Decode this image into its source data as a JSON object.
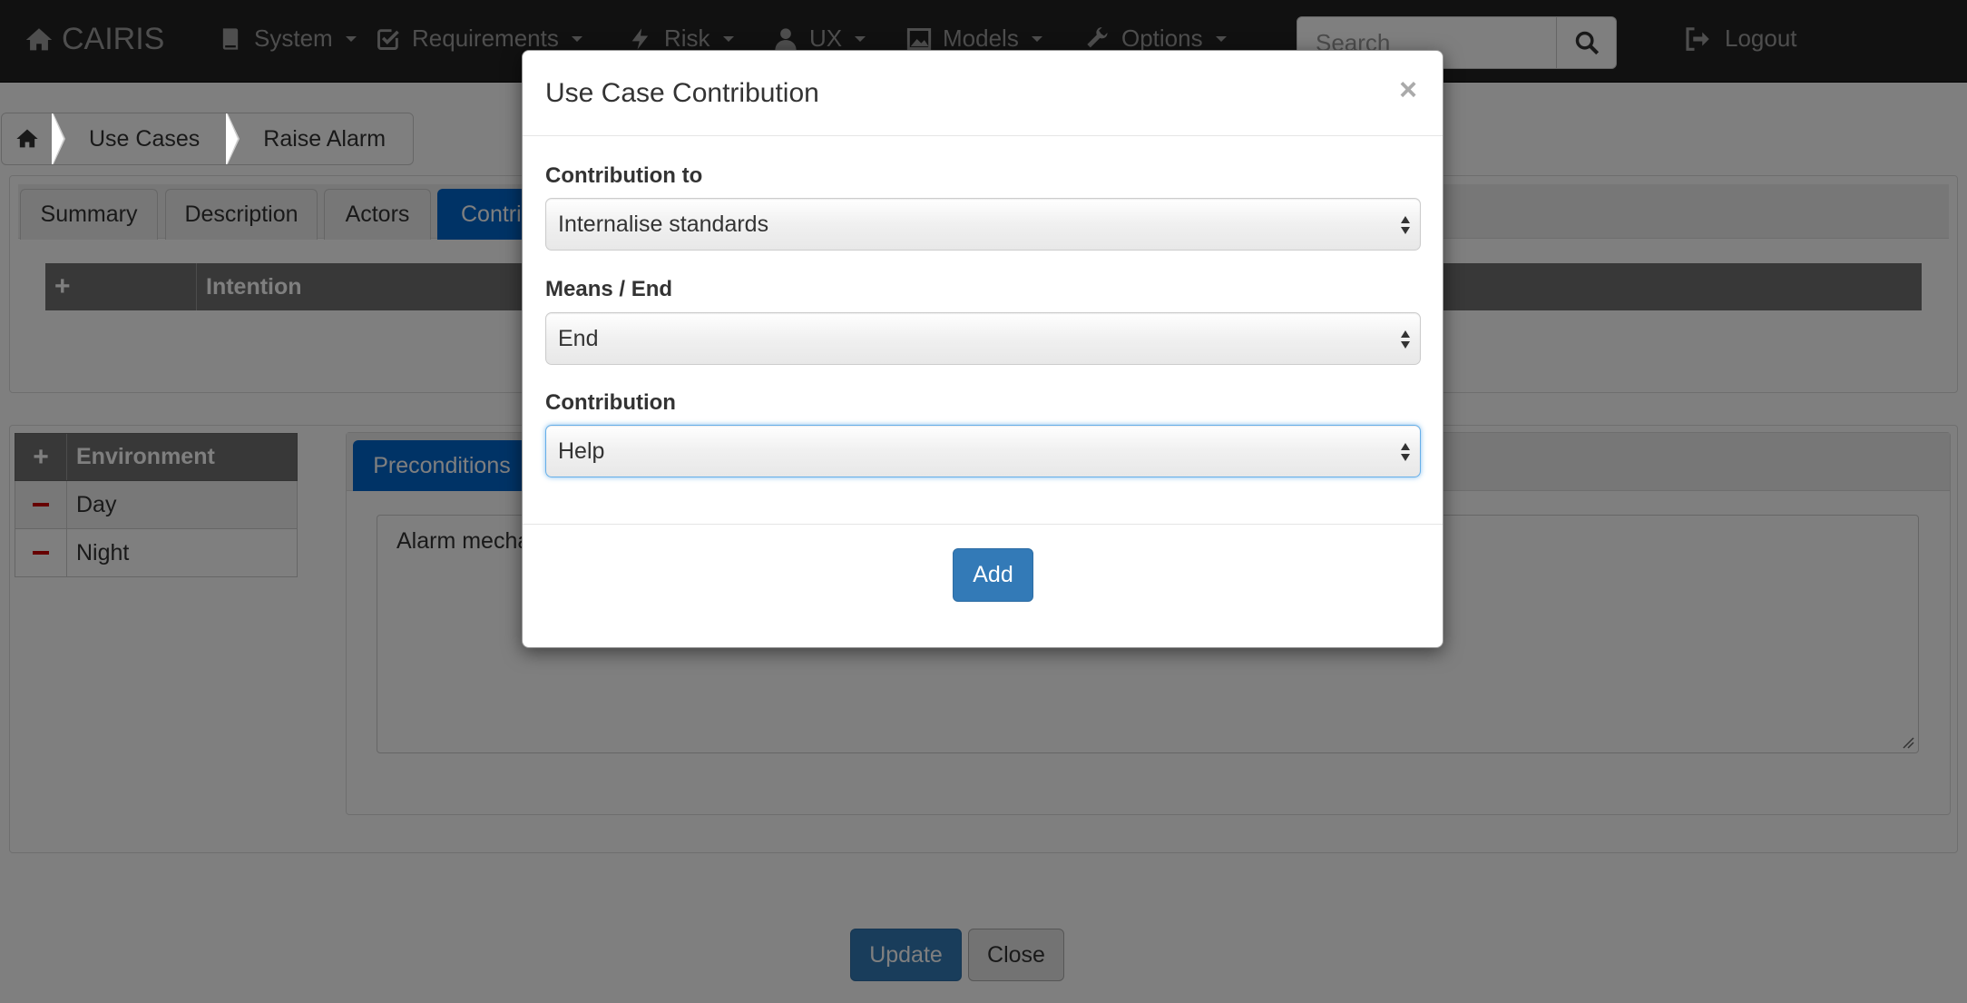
{
  "navbar": {
    "brand": "CAIRIS",
    "menus": [
      {
        "label": "System",
        "icon": "book-icon"
      },
      {
        "label": "Requirements",
        "icon": "check-square-icon"
      },
      {
        "label": "Risk",
        "icon": "bolt-icon"
      },
      {
        "label": "UX",
        "icon": "user-icon"
      },
      {
        "label": "Models",
        "icon": "image-icon"
      },
      {
        "label": "Options",
        "icon": "wrench-icon"
      }
    ],
    "search_placeholder": "Search",
    "logout": "Logout"
  },
  "breadcrumb": [
    "Use Cases",
    "Raise Alarm"
  ],
  "tabs": [
    "Summary",
    "Description",
    "Actors",
    "Contri"
  ],
  "intention_table": {
    "plus": "+",
    "header": "Intention"
  },
  "environments": {
    "plus": "+",
    "header": "Environment",
    "rows": [
      "Day",
      "Night"
    ]
  },
  "sub_tab": "Preconditions",
  "preconditions_text": "Alarm mecha",
  "buttons": {
    "update": "Update",
    "close": "Close"
  },
  "modal": {
    "title": "Use Case Contribution",
    "close_symbol": "×",
    "fields": [
      {
        "label": "Contribution to",
        "value": "Internalise standards"
      },
      {
        "label": "Means / End",
        "value": "End"
      },
      {
        "label": "Contribution",
        "value": "Help"
      }
    ],
    "add_button": "Add"
  },
  "colors": {
    "primary": "#337ab7",
    "tab_active": "#0066cc",
    "navbar": "#222222",
    "danger": "#cc0000"
  }
}
